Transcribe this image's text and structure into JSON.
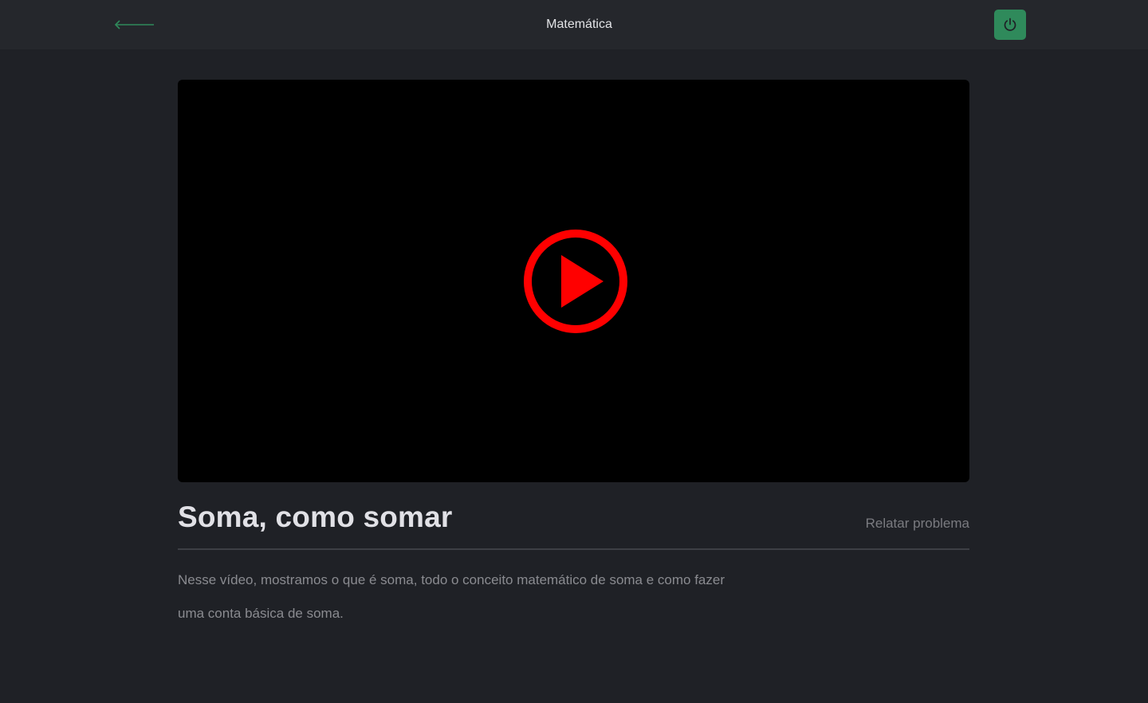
{
  "header": {
    "title": "Matemática",
    "back_icon": "arrow-left-icon",
    "logout_icon": "power-icon",
    "accent_color": "#2f8a5b"
  },
  "video": {
    "play_icon": "play-circle-icon",
    "play_color": "#ff0000",
    "background": "#000000"
  },
  "lesson": {
    "title": "Soma, como somar",
    "report_label": "Relatar problema",
    "description": "Nesse vídeo, mostramos o que é soma, todo o conceito matemático de soma e como fazer uma conta básica de soma."
  }
}
